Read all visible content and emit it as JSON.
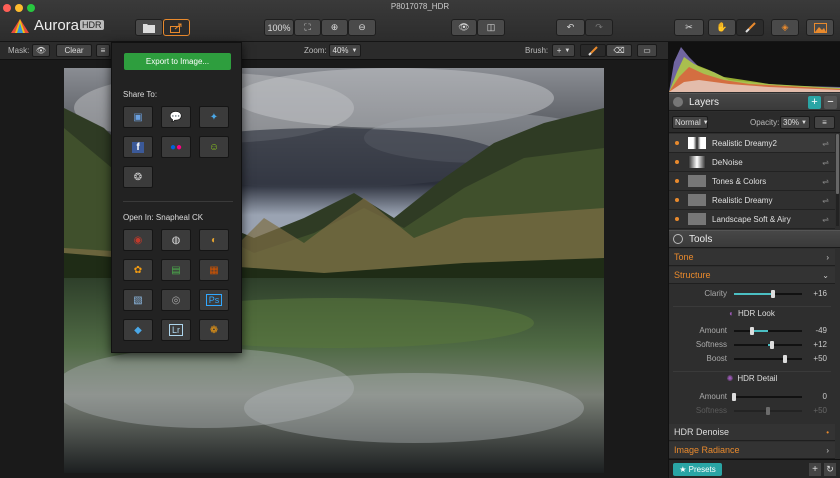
{
  "window": {
    "title": "P8017078_HDR"
  },
  "app": {
    "name": "Aurora",
    "badge": "HDR"
  },
  "toolbar": {
    "zoom_fit_label": "100%"
  },
  "options_bar": {
    "mask_label": "Mask:",
    "clear_label": "Clear",
    "zoom_label": "Zoom:",
    "zoom_value": "40%",
    "brush_label": "Brush:",
    "brush_add": "+"
  },
  "popup": {
    "export_label": "Export to Image...",
    "share_label": "Share To:",
    "open_in_label": "Open In: Snapheal CK",
    "photoshop_label": "Ps",
    "lightroom_label": "Lr"
  },
  "layers": {
    "title": "Layers",
    "blend_mode": "Normal",
    "opacity_label": "Opacity:",
    "opacity_value": "30%",
    "items": [
      {
        "name": "Realistic Dreamy2"
      },
      {
        "name": "DeNoise"
      },
      {
        "name": "Tones & Colors"
      },
      {
        "name": "Realistic Dreamy"
      },
      {
        "name": "Landscape Soft & Airy"
      }
    ]
  },
  "tools": {
    "title": "Tools",
    "tone_label": "Tone",
    "structure_label": "Structure",
    "clarity": {
      "label": "Clarity",
      "value": "+16",
      "fraction": 0.58
    },
    "hdr_look": {
      "title": "HDR Look",
      "amount": {
        "label": "Amount",
        "value": "-49",
        "fraction": 0.26
      },
      "softness": {
        "label": "Softness",
        "value": "+12",
        "fraction": 0.56
      },
      "boost": {
        "label": "Boost",
        "value": "+50",
        "fraction": 0.75
      }
    },
    "hdr_detail": {
      "title": "HDR Detail",
      "amount": {
        "label": "Amount",
        "value": "0",
        "fraction": 0.0
      },
      "softness": {
        "label": "Softness",
        "value": "+50",
        "fraction": 0.5
      }
    },
    "hdr_denoise_label": "HDR Denoise",
    "image_radiance_label": "Image Radiance"
  },
  "presets": {
    "label": "★ Presets"
  },
  "colors": {
    "accent_orange": "#e98a2d",
    "accent_teal": "#2aa5a5",
    "export_green": "#2e9e3e"
  }
}
